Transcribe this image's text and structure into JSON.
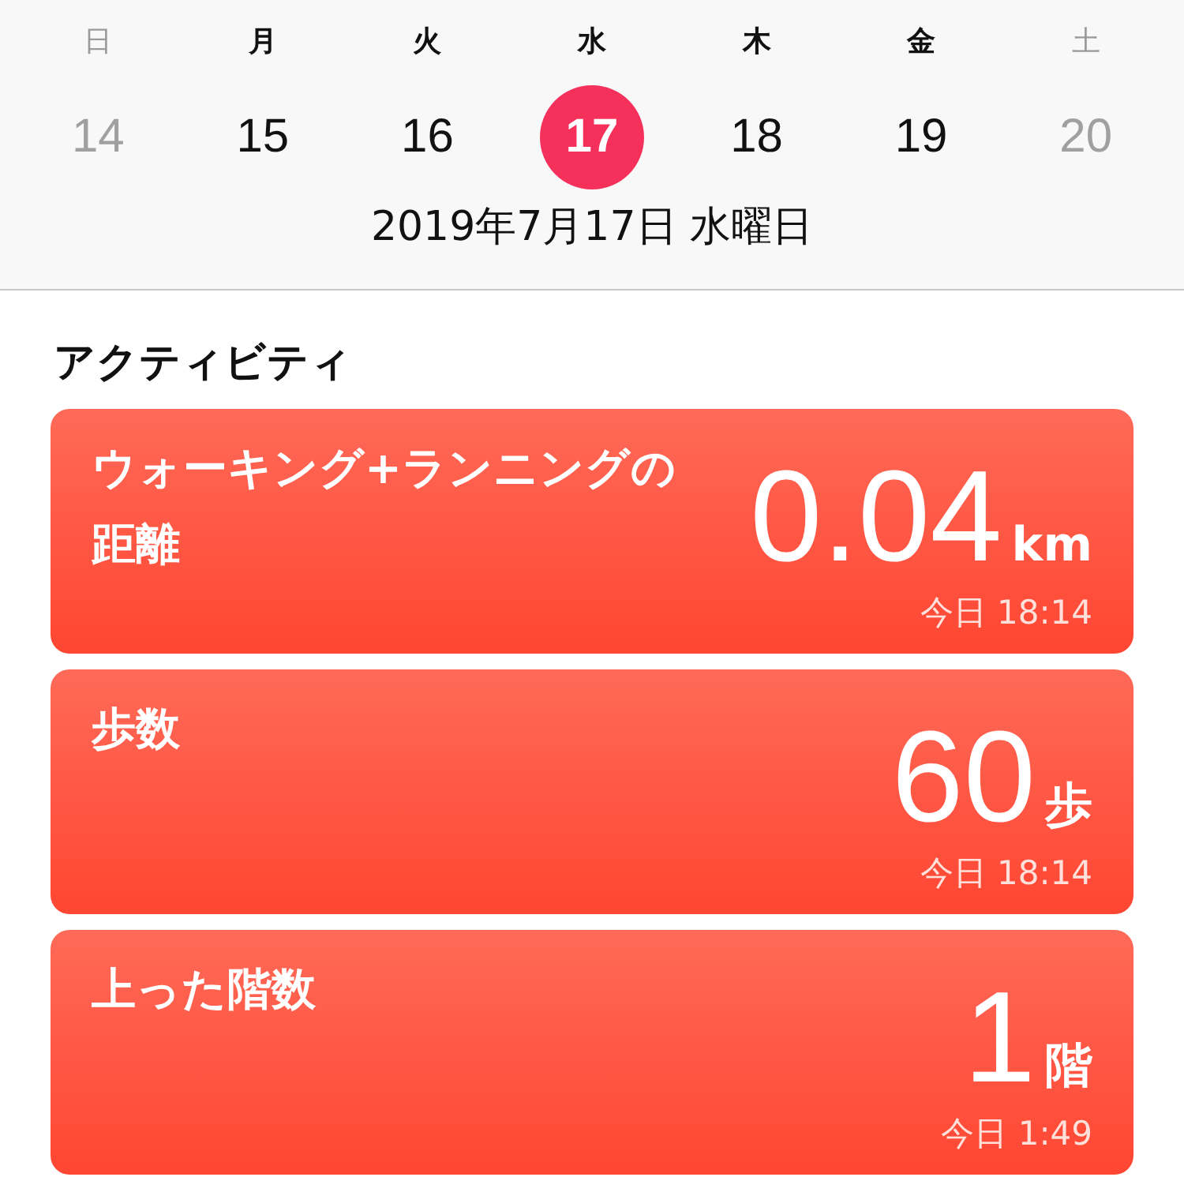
{
  "week": [
    {
      "weekday": "日",
      "day": "14",
      "selected": false,
      "dimmed": true
    },
    {
      "weekday": "月",
      "day": "15",
      "selected": false,
      "dimmed": false
    },
    {
      "weekday": "火",
      "day": "16",
      "selected": false,
      "dimmed": false
    },
    {
      "weekday": "水",
      "day": "17",
      "selected": true,
      "dimmed": false
    },
    {
      "weekday": "木",
      "day": "18",
      "selected": false,
      "dimmed": false
    },
    {
      "weekday": "金",
      "day": "19",
      "selected": false,
      "dimmed": false
    },
    {
      "weekday": "土",
      "day": "20",
      "selected": false,
      "dimmed": true
    }
  ],
  "date_label": "2019年7月17日 水曜日",
  "section_title": "アクティビティ",
  "cards": [
    {
      "title": "ウォーキング+ランニングの距離",
      "value": "0.04",
      "unit": "km",
      "time": "今日 18:14"
    },
    {
      "title": "歩数",
      "value": "60",
      "unit": "歩",
      "time": "今日 18:14"
    },
    {
      "title": "上った階数",
      "value": "1",
      "unit": "階",
      "time": "今日 1:49"
    }
  ]
}
